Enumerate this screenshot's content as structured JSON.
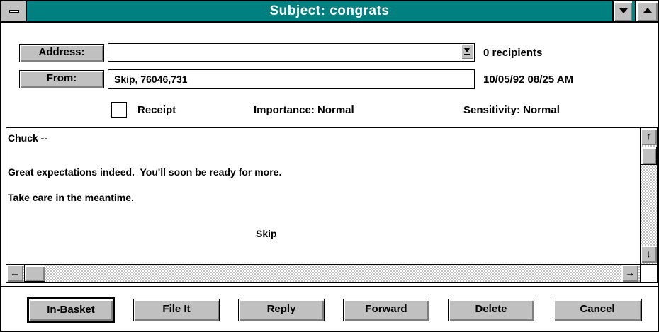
{
  "window": {
    "title": "Subject: congrats"
  },
  "header": {
    "address_button": "Address:",
    "address_value": "",
    "recipients": "0 recipients",
    "from_button": "From:",
    "from_value": "Skip, 76046,731",
    "datetime": "10/05/92 08/25 AM",
    "receipt_label": "Receipt",
    "receipt_checked": false,
    "importance": "Importance: Normal",
    "sensitivity": "Sensitivity: Normal"
  },
  "message": {
    "lines": [
      "Chuck --",
      "Great expectations indeed.  You'll soon be ready for more.",
      "Take care in the meantime.",
      "Skip"
    ]
  },
  "buttons": {
    "in_basket": "In-Basket",
    "file_it": "File It",
    "reply": "Reply",
    "forward": "Forward",
    "delete": "Delete",
    "cancel": "Cancel"
  },
  "colors": {
    "title_bar": "#008080",
    "face": "#c0c0c0"
  },
  "icons": [
    "system-menu-icon",
    "minimize-arrow-icon",
    "maximize-arrow-icon",
    "dropdown-arrow-icon",
    "scroll-up-icon",
    "scroll-down-icon",
    "scroll-left-icon",
    "scroll-right-icon"
  ]
}
